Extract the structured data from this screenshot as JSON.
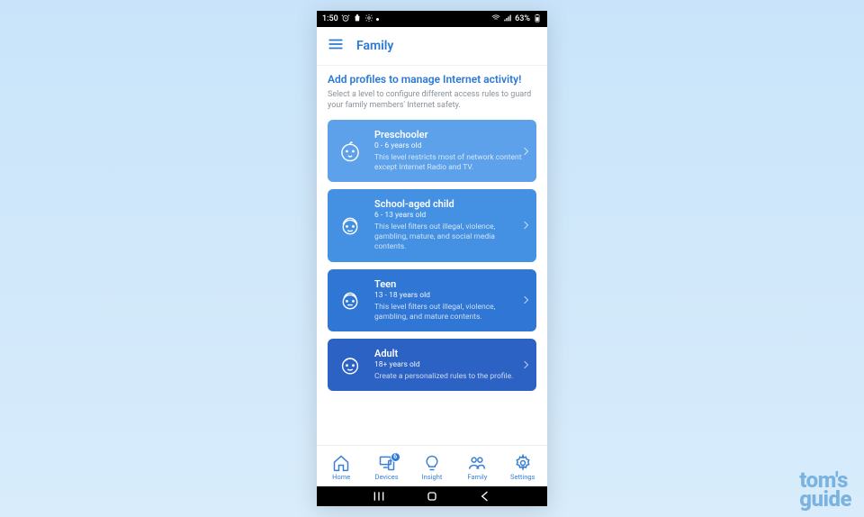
{
  "statusbar": {
    "time": "1:50",
    "battery": "63%"
  },
  "header": {
    "title": "Family"
  },
  "content": {
    "headline": "Add profiles to manage Internet activity!",
    "subhead": "Select a level to configure different access rules to guard your family members' Internet safety."
  },
  "cards": [
    {
      "title": "Preschooler",
      "age": "0 - 6 years old",
      "desc": "This level restricts most of network content except Internet Radio and TV.",
      "color": "#5ca1ea"
    },
    {
      "title": "School-aged child",
      "age": "6 - 13 years old",
      "desc": "This level filters out illegal, violence, gambling, mature, and social media contents.",
      "color": "#4490e2"
    },
    {
      "title": "Teen",
      "age": "13 - 18 years old",
      "desc": "This level filters out illegal, violence, gambling, and mature contents.",
      "color": "#3076d5"
    },
    {
      "title": "Adult",
      "age": "18+ years old",
      "desc": "Create a personalized rules to the profile.",
      "color": "#2b62c4"
    }
  ],
  "nav": {
    "home": "Home",
    "devices": "Devices",
    "devicesBadge": "6",
    "insight": "Insight",
    "family": "Family",
    "settings": "Settings"
  },
  "watermark": {
    "line1": "tom's",
    "line2": "guide"
  }
}
